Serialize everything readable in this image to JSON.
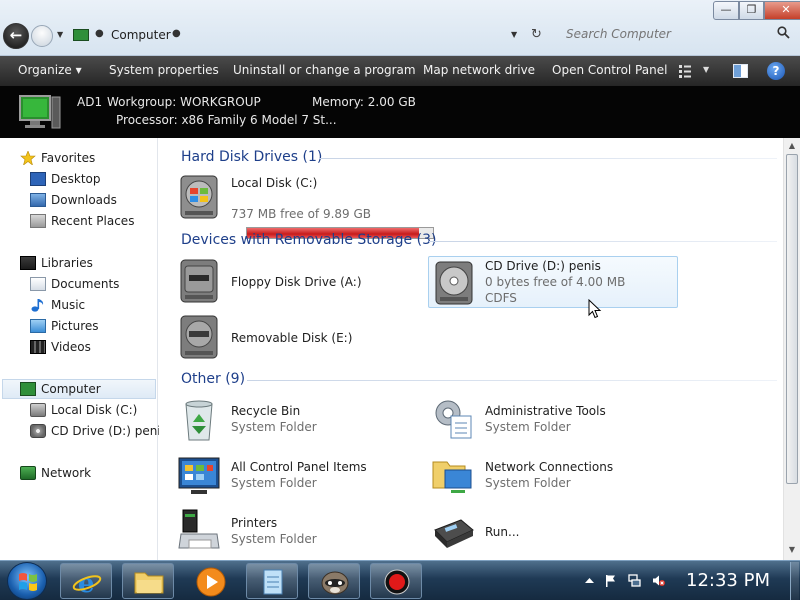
{
  "window": {
    "address": "Computer",
    "search_placeholder": "Search Computer",
    "min_glyph": "—",
    "max_glyph": "❐",
    "close_glyph": "✕"
  },
  "toolbar": {
    "organize": "Organize ▾",
    "system_properties": "System properties",
    "uninstall": "Uninstall or change a program",
    "map_drive": "Map network drive",
    "control_panel": "Open Control Panel",
    "help": "?"
  },
  "details": {
    "name": "AD1",
    "workgroup": "Workgroup: WORKGROUP",
    "memory": "Memory: 2.00 GB",
    "processor": "Processor: x86 Family 6 Model 7 St..."
  },
  "nav": {
    "favorites": "Favorites",
    "desktop": "Desktop",
    "downloads": "Downloads",
    "recent": "Recent Places",
    "libraries": "Libraries",
    "documents": "Documents",
    "music": "Music",
    "pictures": "Pictures",
    "videos": "Videos",
    "computer": "Computer",
    "local_disk": "Local Disk (C:)",
    "cd_drive": "CD Drive (D:) penis",
    "network": "Network"
  },
  "groups": {
    "hdd": "Hard Disk Drives (1)",
    "removable": "Devices with Removable Storage (3)",
    "other": "Other (9)"
  },
  "items": {
    "local_disk": {
      "name": "Local Disk (C:)",
      "free": "737 MB free of 9.89 GB",
      "used_fraction": 0.927
    },
    "floppy": {
      "name": "Floppy Disk Drive (A:)"
    },
    "cd": {
      "name": "CD Drive (D:) penis",
      "free": "0 bytes free of 4.00 MB",
      "fs": "CDFS"
    },
    "removable": {
      "name": "Removable Disk (E:)"
    },
    "recycle": {
      "name": "Recycle Bin",
      "sub": "System Folder"
    },
    "admin": {
      "name": "Administrative Tools",
      "sub": "System Folder"
    },
    "control_panel": {
      "name": "All Control Panel Items",
      "sub": "System Folder"
    },
    "network_conn": {
      "name": "Network Connections",
      "sub": "System Folder"
    },
    "printers": {
      "name": "Printers",
      "sub": "System Folder"
    },
    "run": {
      "name": "Run..."
    }
  },
  "taskbar": {
    "clock": "12:33 PM"
  },
  "colors": {
    "group_heading": "#1e3f8a",
    "toolbar_bg": "#333333",
    "details_bg": "#050505",
    "disk_full": "#c61b1b"
  }
}
